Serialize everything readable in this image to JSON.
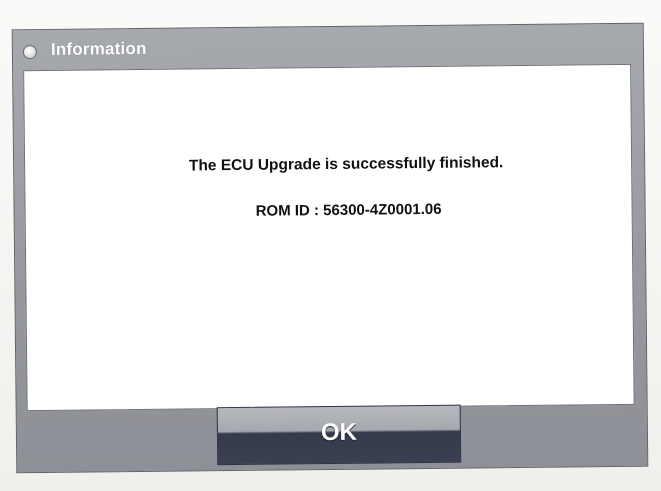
{
  "window": {
    "title": "Information",
    "icon": "info-circle-icon"
  },
  "message": {
    "line1": "The ECU Upgrade is successfully finished.",
    "line2": "ROM ID : 56300-4Z0001.06"
  },
  "buttons": {
    "ok_label": "OK"
  },
  "colors": {
    "frame": "#9b9ea4",
    "content_background": "#ffffff",
    "button_dark": "#3a3f51",
    "title_text": "#ffffff"
  }
}
